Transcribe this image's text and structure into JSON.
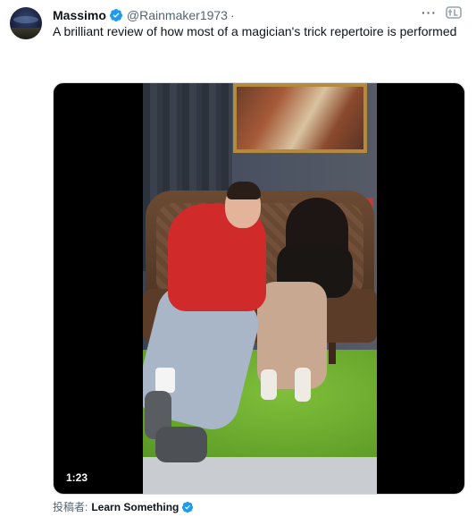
{
  "author": {
    "display_name": "Massimo",
    "handle": "@Rainmaker1973",
    "separator": "·"
  },
  "icons": {
    "more": "more-icon",
    "brand": "brand-logo-icon",
    "verified": "verified-badge-icon"
  },
  "more_label": "···",
  "tweet": {
    "text": "A brilliant review of how most of a magician's trick repertoire is performed"
  },
  "video": {
    "duration": "1:23"
  },
  "attribution": {
    "prefix": "投稿者:",
    "source_name": "Learn Something"
  },
  "colors": {
    "verified_blue": "#1d9bf0",
    "text_primary": "#0f1419",
    "text_secondary": "#536471"
  }
}
